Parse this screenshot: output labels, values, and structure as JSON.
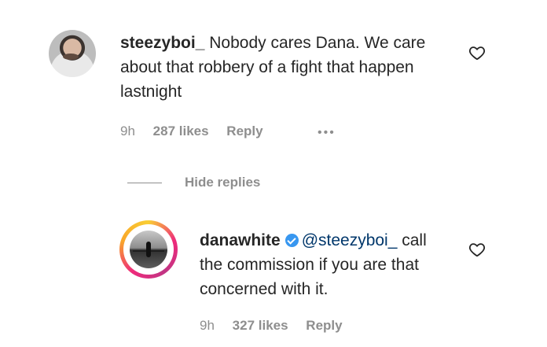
{
  "comments": [
    {
      "username": "steezyboi_",
      "text": "Nobody cares Dana. We care about that robbery of a fight that happen lastnight",
      "time": "9h",
      "likes": "287 likes",
      "reply": "Reply",
      "more": "•••"
    },
    {
      "username": "danawhite",
      "mention": "@steezyboi_",
      "text": "call the commission if you are that concerned with it.",
      "time": "9h",
      "likes": "327 likes",
      "reply": "Reply"
    }
  ],
  "hide_replies_label": "Hide replies",
  "icons": {
    "like": "heart-outline-icon",
    "verified": "verified-badge-icon",
    "more": "more-horizontal-icon"
  },
  "colors": {
    "text": "#262626",
    "muted": "#8e8e8e",
    "link": "#00376b",
    "verified": "#3897f0"
  }
}
